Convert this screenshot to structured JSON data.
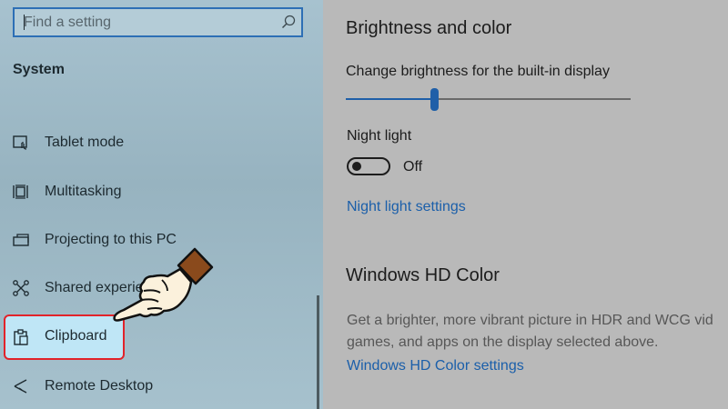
{
  "sidebar": {
    "search": {
      "placeholder": "Find a setting",
      "icon": "search-icon"
    },
    "section_title": "System",
    "items": [
      {
        "label": "Tablet mode",
        "icon": "tablet-mode-icon",
        "selected": false
      },
      {
        "label": "Multitasking",
        "icon": "multitasking-icon",
        "selected": false
      },
      {
        "label": "Projecting to this PC",
        "icon": "projecting-icon",
        "selected": false
      },
      {
        "label": "Shared experiences",
        "icon": "shared-experiences-icon",
        "selected": false
      },
      {
        "label": "Clipboard",
        "icon": "clipboard-icon",
        "selected": true
      },
      {
        "label": "Remote Desktop",
        "icon": "remote-desktop-icon",
        "selected": false
      }
    ]
  },
  "main": {
    "brightness_heading": "Brightness and color",
    "brightness_label": "Change brightness for the built-in display",
    "brightness_value": 0.31,
    "night_light_label": "Night light",
    "night_light_state": "Off",
    "night_light_link": "Night light settings",
    "hdr_heading": "Windows HD Color",
    "hdr_description_lines": [
      "Get a brighter, more vibrant picture in HDR and WCG vid",
      "games, and apps on the display selected above."
    ],
    "hdr_link": "Windows HD Color settings"
  },
  "colors": {
    "accent": "#1f5fa8",
    "highlight_border": "#e2232a",
    "selected_background": "#bfe6f6",
    "sidebar_background": "#a2bdca",
    "main_background": "#b9b9b9"
  }
}
